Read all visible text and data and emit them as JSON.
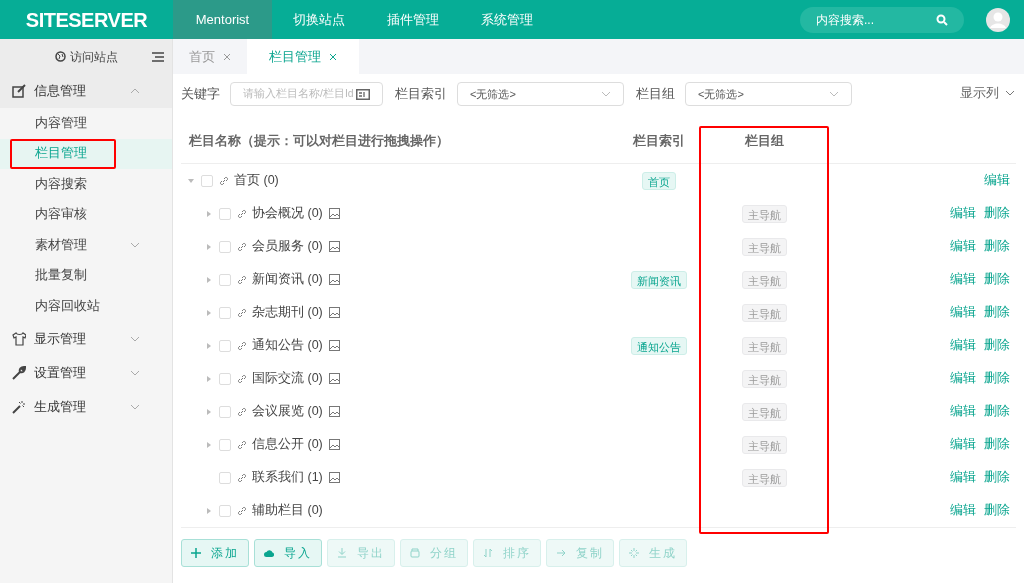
{
  "header": {
    "logo": "SITESERVER",
    "nav": [
      {
        "label": "Mentorist",
        "selected": true
      },
      {
        "label": "切换站点",
        "selected": false
      },
      {
        "label": "插件管理",
        "selected": false
      },
      {
        "label": "系统管理",
        "selected": false
      }
    ],
    "search": {
      "placeholder": "内容搜索..."
    }
  },
  "sidebar": {
    "visit": "访问站点",
    "groups": [
      {
        "label": "信息管理",
        "expanded": true,
        "items": [
          {
            "label": "内容管理",
            "selected": false,
            "highlighted": false,
            "has_children": false
          },
          {
            "label": "栏目管理",
            "selected": true,
            "highlighted": true,
            "has_children": false
          },
          {
            "label": "内容搜索",
            "selected": false,
            "highlighted": false,
            "has_children": false
          },
          {
            "label": "内容审核",
            "selected": false,
            "highlighted": false,
            "has_children": false
          },
          {
            "label": "素材管理",
            "selected": false,
            "highlighted": false,
            "has_children": true
          },
          {
            "label": "批量复制",
            "selected": false,
            "highlighted": false,
            "has_children": false
          },
          {
            "label": "内容回收站",
            "selected": false,
            "highlighted": false,
            "has_children": false
          }
        ]
      },
      {
        "label": "显示管理",
        "expanded": false
      },
      {
        "label": "设置管理",
        "expanded": false
      },
      {
        "label": "生成管理",
        "expanded": false
      }
    ]
  },
  "tabs": [
    {
      "label": "首页",
      "selected": false
    },
    {
      "label": "栏目管理",
      "selected": true
    }
  ],
  "filters": {
    "keyword_label": "关键字",
    "keyword_placeholder": "请输入栏目名称/栏目Id",
    "index_label": "栏目索引",
    "index_value": "<无筛选>",
    "group_label": "栏目组",
    "group_value": "<无筛选>",
    "columns_button": "显示列"
  },
  "table": {
    "columns": [
      {
        "label": "栏目名称（提示：可以对栏目进行拖拽操作）",
        "highlighted": false
      },
      {
        "label": "栏目索引",
        "highlighted": false
      },
      {
        "label": "栏目组",
        "highlighted": true
      }
    ],
    "rows": [
      {
        "label": "首页 (0)",
        "expandable": true,
        "expanded": true,
        "checked": false,
        "has_image": false,
        "index": "首页",
        "actions": [
          "编辑"
        ],
        "children": [
          {
            "label": "协会概况 (0)",
            "expandable": true,
            "checked": false,
            "has_image": true,
            "group": "主导航",
            "actions": [
              "编辑",
              "删除"
            ]
          },
          {
            "label": "会员服务 (0)",
            "expandable": true,
            "checked": false,
            "has_image": true,
            "group": "主导航",
            "actions": [
              "编辑",
              "删除"
            ]
          },
          {
            "label": "新闻资讯 (0)",
            "expandable": true,
            "checked": false,
            "has_image": true,
            "index": "新闻资讯",
            "group": "主导航",
            "actions": [
              "编辑",
              "删除"
            ]
          },
          {
            "label": "杂志期刊 (0)",
            "expandable": true,
            "checked": false,
            "has_image": true,
            "group": "主导航",
            "actions": [
              "编辑",
              "删除"
            ]
          },
          {
            "label": "通知公告 (0)",
            "expandable": true,
            "checked": false,
            "has_image": true,
            "index": "通知公告",
            "group": "主导航",
            "actions": [
              "编辑",
              "删除"
            ]
          },
          {
            "label": "国际交流 (0)",
            "expandable": true,
            "checked": false,
            "has_image": true,
            "group": "主导航",
            "actions": [
              "编辑",
              "删除"
            ]
          },
          {
            "label": "会议展览 (0)",
            "expandable": true,
            "checked": false,
            "has_image": true,
            "group": "主导航",
            "actions": [
              "编辑",
              "删除"
            ]
          },
          {
            "label": "信息公开 (0)",
            "expandable": true,
            "checked": false,
            "has_image": true,
            "group": "主导航",
            "actions": [
              "编辑",
              "删除"
            ]
          },
          {
            "label": "联系我们 (1)",
            "expandable": false,
            "checked": false,
            "has_image": true,
            "group": "主导航",
            "actions": [
              "编辑",
              "删除"
            ]
          },
          {
            "label": "辅助栏目 (0)",
            "expandable": true,
            "checked": false,
            "has_image": false,
            "actions": [
              "编辑",
              "删除"
            ]
          }
        ]
      }
    ]
  },
  "buttons": [
    {
      "label": "添加",
      "disabled": false
    },
    {
      "label": "导入",
      "disabled": false
    },
    {
      "label": "导出",
      "disabled": true
    },
    {
      "label": "分组",
      "disabled": true
    },
    {
      "label": "排序",
      "disabled": true
    },
    {
      "label": "复制",
      "disabled": true
    },
    {
      "label": "生成",
      "disabled": true
    }
  ]
}
